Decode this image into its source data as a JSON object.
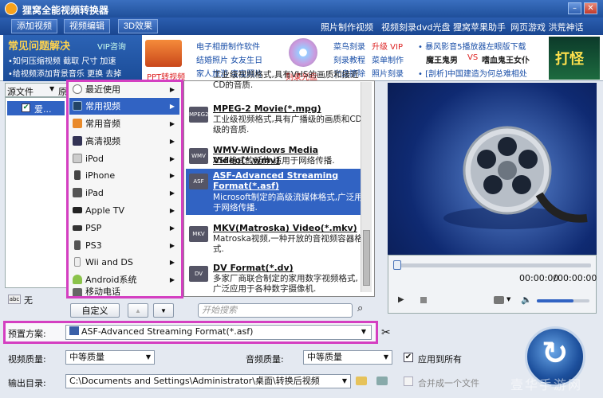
{
  "window": {
    "title": "狸窝全能视频转换器"
  },
  "menubar": {
    "tabs": [
      "添加视频",
      "视频编辑",
      "3D效果"
    ],
    "links": [
      "照片制作视频",
      "视频刻录dvd光盘",
      "狸窝苹果助手",
      "网页游戏 洪荒神话"
    ]
  },
  "ads": {
    "faq_title": "常见问题解决",
    "faq_vip": "VIP咨询",
    "faq_line1": "•如何压缩视频 截取 尺寸 加速",
    "faq_line2": "•给视频添加背景音乐 更换 去掉",
    "ppt_label": "PPT转视频",
    "col2": [
      "电子相册制作软件",
      "结婚照片 女友生日",
      "家人旅游 宝宝照片"
    ],
    "disc_label": "刻录光盘",
    "col3a": [
      "菜鸟刻录",
      "刻录教程",
      "光盘擦除"
    ],
    "col3b": [
      "升级 VIP",
      "菜单制作",
      "照片刻录"
    ],
    "col4": [
      "• 暴风影音5播放器左眼版下载",
      "魔王鬼男",
      "VS",
      "嗜血鬼王女仆",
      "• [剖析]中国建造为何总难相处"
    ],
    "game_label": "打怪"
  },
  "filelist": {
    "col1": "源文件",
    "col2": "原",
    "item": "爱..."
  },
  "category_menu": {
    "items": [
      "最近使用",
      "常用视频",
      "常用音频",
      "高清视频",
      "iPod",
      "iPhone",
      "iPad",
      "Apple TV",
      "PSP",
      "PS3",
      "Wii and DS",
      "Android系统",
      "移动电话"
    ],
    "selected": 1,
    "custom_button": "自定义",
    "search_placeholder": "开始搜索"
  },
  "formats": [
    {
      "name": "",
      "desc": "工业级视频格式,具有VHS的画质和接近CD的音质."
    },
    {
      "name": "MPEG-2 Movie(*.mpg)",
      "desc": "工业级视频格式,具有广播级的画质和CD级的音质."
    },
    {
      "name": "WMV-Windows Media Video(*.wmv)",
      "desc": "ASF格式的延伸,适用于网络传播."
    },
    {
      "name": "ASF-Advanced Streaming Format(*.asf)",
      "desc": "Microsoft制定的高级流媒体格式,广泛用于网络传播."
    },
    {
      "name": "MKV(Matroska) Video(*.mkv)",
      "desc": "Matroska视频,一种开放的音视频容器格式."
    },
    {
      "name": "DV Format(*.dv)",
      "desc": "多家厂商联合制定的家用数字视频格式,广泛应用于各种数字摄像机."
    }
  ],
  "format_icons": [
    "MPEG1",
    "MPEG2",
    "WMV",
    "ASF",
    "MKV",
    "DV"
  ],
  "selected_format": 3,
  "player": {
    "time_current": "00:00:00",
    "time_total": "00:00:00",
    "progress": 0,
    "volume": 0.7
  },
  "subtitle": {
    "value": "无"
  },
  "preset": {
    "label": "预置方案:",
    "value": "ASF-Advanced Streaming Format(*.asf)"
  },
  "settings": {
    "video_quality_label": "视频质量:",
    "video_quality_value": "中等质量",
    "audio_quality_label": "音频质量:",
    "audio_quality_value": "中等质量",
    "apply_all": "应用到所有",
    "output_label": "输出目录:",
    "output_path": "C:\\Documents and Settings\\Administrator\\桌面\\转换后视频",
    "merge": "合并成一个文件"
  },
  "watermark": "壹华手游网",
  "colors": {
    "accent": "#3163c3",
    "highlight": "#d43fc1",
    "title": "#1f4f9a"
  }
}
